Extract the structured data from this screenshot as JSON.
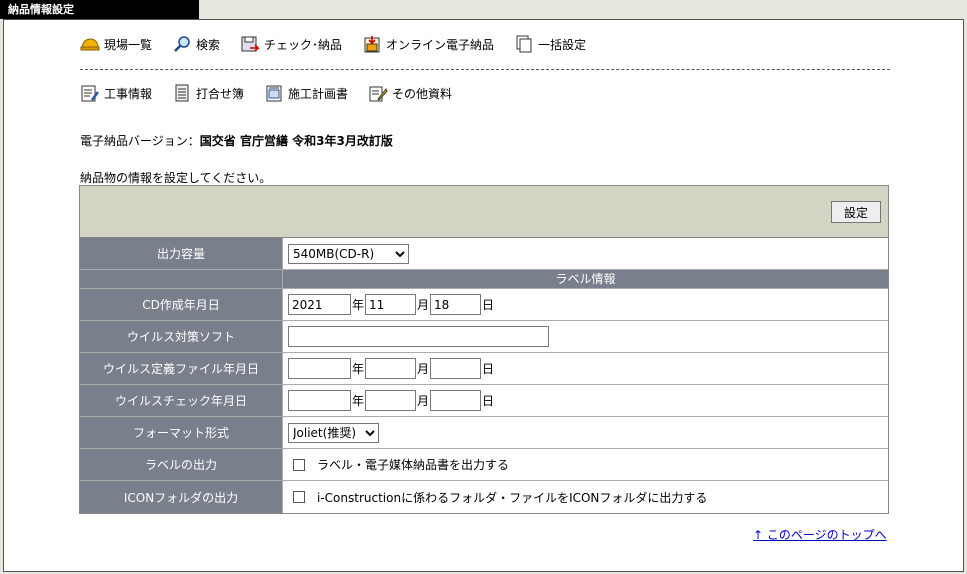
{
  "window": {
    "title": "納品情報設定"
  },
  "toolbar1": [
    {
      "label": "現場一覧",
      "icon": "helmet-icon"
    },
    {
      "label": "検索",
      "icon": "magnifier-icon"
    },
    {
      "label": "チェック･納品",
      "icon": "check-deliver-icon"
    },
    {
      "label": "オンライン電子納品",
      "icon": "online-deliver-icon"
    },
    {
      "label": "一括設定",
      "icon": "copy-pages-icon"
    }
  ],
  "toolbar2": [
    {
      "label": "工事情報",
      "icon": "edit-document-icon"
    },
    {
      "label": "打合せ簿",
      "icon": "notebook-icon"
    },
    {
      "label": "施工計画書",
      "icon": "plan-document-icon"
    },
    {
      "label": "その他資料",
      "icon": "pencil-document-icon"
    }
  ],
  "version": {
    "prefix": "電子納品バージョン：",
    "value": "国交省 官庁営繕 令和3年3月改訂版"
  },
  "instruction": "納品物の情報を設定してください。",
  "set_button": "設定",
  "form": {
    "capacity": {
      "label": "出力容量",
      "selected": "540MB(CD-R)"
    },
    "label_section": "ラベル情報",
    "cd_date": {
      "label": "CD作成年月日",
      "year": "2021",
      "month": "11",
      "day": "18"
    },
    "antivirus": {
      "label": "ウイルス対策ソフト",
      "value": ""
    },
    "def_date": {
      "label": "ウイルス定義ファイル年月日",
      "year": "",
      "month": "",
      "day": ""
    },
    "check_date": {
      "label": "ウイルスチェック年月日",
      "year": "",
      "month": "",
      "day": ""
    },
    "format": {
      "label": "フォーマット形式",
      "selected": "Joliet(推奨)"
    },
    "label_output": {
      "label": "ラベルの出力",
      "checkbox_text": "ラベル・電子媒体納品書を出力する",
      "checked": false
    },
    "icon_output": {
      "label": "ICONフォルダの出力",
      "checkbox_text": "i-Constructionに係わるフォルダ・ファイルをICONフォルダに出力する",
      "checked": false
    }
  },
  "units": {
    "year": "年",
    "month": "月",
    "day": "日"
  },
  "top_link": "↑ このページのトップへ"
}
